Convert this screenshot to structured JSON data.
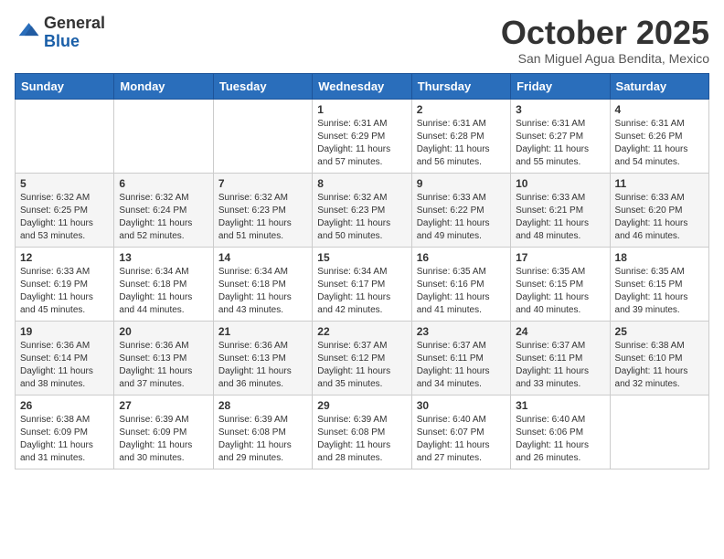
{
  "logo": {
    "general": "General",
    "blue": "Blue"
  },
  "header": {
    "month": "October 2025",
    "location": "San Miguel Agua Bendita, Mexico"
  },
  "days_of_week": [
    "Sunday",
    "Monday",
    "Tuesday",
    "Wednesday",
    "Thursday",
    "Friday",
    "Saturday"
  ],
  "weeks": [
    [
      {
        "day": "",
        "info": ""
      },
      {
        "day": "",
        "info": ""
      },
      {
        "day": "",
        "info": ""
      },
      {
        "day": "1",
        "info": "Sunrise: 6:31 AM\nSunset: 6:29 PM\nDaylight: 11 hours and 57 minutes."
      },
      {
        "day": "2",
        "info": "Sunrise: 6:31 AM\nSunset: 6:28 PM\nDaylight: 11 hours and 56 minutes."
      },
      {
        "day": "3",
        "info": "Sunrise: 6:31 AM\nSunset: 6:27 PM\nDaylight: 11 hours and 55 minutes."
      },
      {
        "day": "4",
        "info": "Sunrise: 6:31 AM\nSunset: 6:26 PM\nDaylight: 11 hours and 54 minutes."
      }
    ],
    [
      {
        "day": "5",
        "info": "Sunrise: 6:32 AM\nSunset: 6:25 PM\nDaylight: 11 hours and 53 minutes."
      },
      {
        "day": "6",
        "info": "Sunrise: 6:32 AM\nSunset: 6:24 PM\nDaylight: 11 hours and 52 minutes."
      },
      {
        "day": "7",
        "info": "Sunrise: 6:32 AM\nSunset: 6:23 PM\nDaylight: 11 hours and 51 minutes."
      },
      {
        "day": "8",
        "info": "Sunrise: 6:32 AM\nSunset: 6:23 PM\nDaylight: 11 hours and 50 minutes."
      },
      {
        "day": "9",
        "info": "Sunrise: 6:33 AM\nSunset: 6:22 PM\nDaylight: 11 hours and 49 minutes."
      },
      {
        "day": "10",
        "info": "Sunrise: 6:33 AM\nSunset: 6:21 PM\nDaylight: 11 hours and 48 minutes."
      },
      {
        "day": "11",
        "info": "Sunrise: 6:33 AM\nSunset: 6:20 PM\nDaylight: 11 hours and 46 minutes."
      }
    ],
    [
      {
        "day": "12",
        "info": "Sunrise: 6:33 AM\nSunset: 6:19 PM\nDaylight: 11 hours and 45 minutes."
      },
      {
        "day": "13",
        "info": "Sunrise: 6:34 AM\nSunset: 6:18 PM\nDaylight: 11 hours and 44 minutes."
      },
      {
        "day": "14",
        "info": "Sunrise: 6:34 AM\nSunset: 6:18 PM\nDaylight: 11 hours and 43 minutes."
      },
      {
        "day": "15",
        "info": "Sunrise: 6:34 AM\nSunset: 6:17 PM\nDaylight: 11 hours and 42 minutes."
      },
      {
        "day": "16",
        "info": "Sunrise: 6:35 AM\nSunset: 6:16 PM\nDaylight: 11 hours and 41 minutes."
      },
      {
        "day": "17",
        "info": "Sunrise: 6:35 AM\nSunset: 6:15 PM\nDaylight: 11 hours and 40 minutes."
      },
      {
        "day": "18",
        "info": "Sunrise: 6:35 AM\nSunset: 6:15 PM\nDaylight: 11 hours and 39 minutes."
      }
    ],
    [
      {
        "day": "19",
        "info": "Sunrise: 6:36 AM\nSunset: 6:14 PM\nDaylight: 11 hours and 38 minutes."
      },
      {
        "day": "20",
        "info": "Sunrise: 6:36 AM\nSunset: 6:13 PM\nDaylight: 11 hours and 37 minutes."
      },
      {
        "day": "21",
        "info": "Sunrise: 6:36 AM\nSunset: 6:13 PM\nDaylight: 11 hours and 36 minutes."
      },
      {
        "day": "22",
        "info": "Sunrise: 6:37 AM\nSunset: 6:12 PM\nDaylight: 11 hours and 35 minutes."
      },
      {
        "day": "23",
        "info": "Sunrise: 6:37 AM\nSunset: 6:11 PM\nDaylight: 11 hours and 34 minutes."
      },
      {
        "day": "24",
        "info": "Sunrise: 6:37 AM\nSunset: 6:11 PM\nDaylight: 11 hours and 33 minutes."
      },
      {
        "day": "25",
        "info": "Sunrise: 6:38 AM\nSunset: 6:10 PM\nDaylight: 11 hours and 32 minutes."
      }
    ],
    [
      {
        "day": "26",
        "info": "Sunrise: 6:38 AM\nSunset: 6:09 PM\nDaylight: 11 hours and 31 minutes."
      },
      {
        "day": "27",
        "info": "Sunrise: 6:39 AM\nSunset: 6:09 PM\nDaylight: 11 hours and 30 minutes."
      },
      {
        "day": "28",
        "info": "Sunrise: 6:39 AM\nSunset: 6:08 PM\nDaylight: 11 hours and 29 minutes."
      },
      {
        "day": "29",
        "info": "Sunrise: 6:39 AM\nSunset: 6:08 PM\nDaylight: 11 hours and 28 minutes."
      },
      {
        "day": "30",
        "info": "Sunrise: 6:40 AM\nSunset: 6:07 PM\nDaylight: 11 hours and 27 minutes."
      },
      {
        "day": "31",
        "info": "Sunrise: 6:40 AM\nSunset: 6:06 PM\nDaylight: 11 hours and 26 minutes."
      },
      {
        "day": "",
        "info": ""
      }
    ]
  ]
}
